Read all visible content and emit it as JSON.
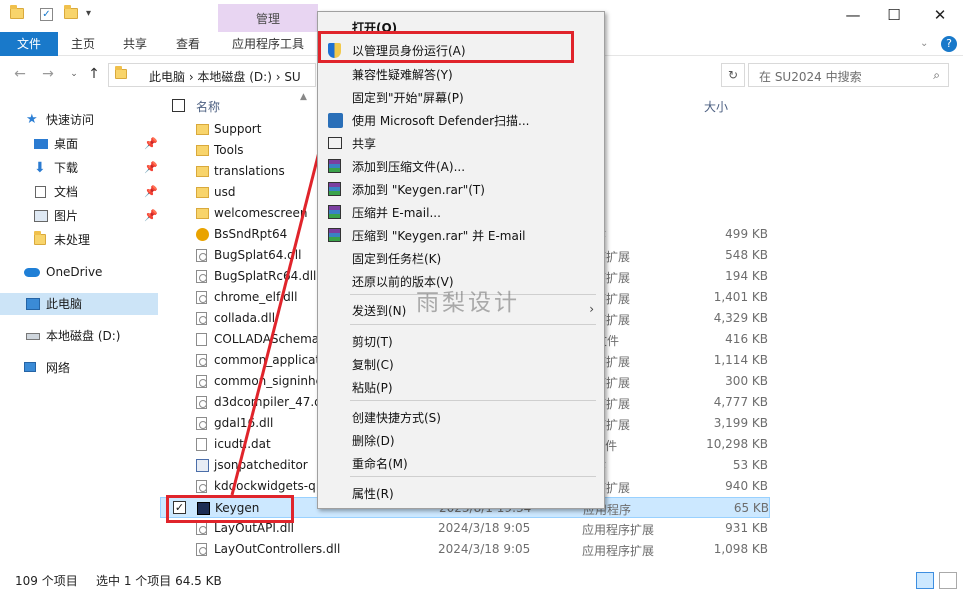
{
  "titlebar": {
    "manage_tab": "管理",
    "minimize": "—",
    "maximize": "☐",
    "close": "✕"
  },
  "ribbon": {
    "tabs": [
      "文件",
      "主页",
      "共享",
      "查看",
      "应用程序工具"
    ]
  },
  "address": {
    "breadcrumb": "此电脑  ›  本地磁盘 (D:)  ›  SU",
    "search_placeholder": "在 SU2024 中搜索"
  },
  "nav": {
    "items": [
      {
        "label": "快速访问",
        "icon": "star-icon"
      },
      {
        "label": "桌面",
        "icon": "desktop-icon",
        "pinned": true
      },
      {
        "label": "下载",
        "icon": "download-icon",
        "pinned": true
      },
      {
        "label": "文档",
        "icon": "document-icon",
        "pinned": true
      },
      {
        "label": "图片",
        "icon": "picture-icon",
        "pinned": true
      },
      {
        "label": "未处理",
        "icon": "folder-icon"
      },
      {
        "label": "OneDrive",
        "icon": "cloud-icon"
      },
      {
        "label": "此电脑",
        "icon": "pc-icon",
        "selected": true
      },
      {
        "label": "本地磁盘 (D:)",
        "icon": "drive-icon"
      },
      {
        "label": "网络",
        "icon": "network-icon"
      }
    ]
  },
  "columns": {
    "name": "名称",
    "size": "大小"
  },
  "files": [
    {
      "name": "Support",
      "date": "",
      "type": "夹",
      "size": "",
      "icon": "folder"
    },
    {
      "name": "Tools",
      "date": "",
      "type": "夹",
      "size": "",
      "icon": "folder"
    },
    {
      "name": "translations",
      "date": "",
      "type": "夹",
      "size": "",
      "icon": "folder"
    },
    {
      "name": "usd",
      "date": "",
      "type": "夹",
      "size": "",
      "icon": "folder"
    },
    {
      "name": "welcomescreen",
      "date": "",
      "type": "夹",
      "size": "",
      "icon": "folder"
    },
    {
      "name": "BsSndRpt64",
      "date": "",
      "type": "程序",
      "size": "499 KB",
      "icon": "bug"
    },
    {
      "name": "BugSplat64.dll",
      "date": "",
      "type": "程序扩展",
      "size": "548 KB",
      "icon": "dll"
    },
    {
      "name": "BugSplatRc64.dll",
      "date": "",
      "type": "程序扩展",
      "size": "194 KB",
      "icon": "dll"
    },
    {
      "name": "chrome_elf.dll",
      "date": "",
      "type": "程序扩展",
      "size": "1,401 KB",
      "icon": "dll"
    },
    {
      "name": "collada.dll",
      "date": "",
      "type": "程序扩展",
      "size": "4,329 KB",
      "icon": "dll"
    },
    {
      "name": "COLLADASchema.",
      "date": "",
      "type": "D 文件",
      "size": "416 KB",
      "icon": "doc"
    },
    {
      "name": "common_applicat",
      "date": "",
      "type": "程序扩展",
      "size": "1,114 KB",
      "icon": "dll"
    },
    {
      "name": "common_signinhe",
      "date": "",
      "type": "程序扩展",
      "size": "300 KB",
      "icon": "dll"
    },
    {
      "name": "d3dcompiler_47.d",
      "date": "",
      "type": "程序扩展",
      "size": "4,777 KB",
      "icon": "dll"
    },
    {
      "name": "gdal16.dll",
      "date": "",
      "type": "程序扩展",
      "size": "3,199 KB",
      "icon": "dll"
    },
    {
      "name": "icudtl.dat",
      "date": "",
      "type": "T 文件",
      "size": "10,298 KB",
      "icon": "doc"
    },
    {
      "name": "jsonpatcheditor",
      "date": "",
      "type": "程序",
      "size": "53 KB",
      "icon": "app"
    },
    {
      "name": "kddockwidgets-q",
      "date": "",
      "type": "程序扩展",
      "size": "940 KB",
      "icon": "dll"
    },
    {
      "name": "Keygen",
      "date": "2023/8/1 19:34",
      "type": "应用程序",
      "size": "65 KB",
      "icon": "key",
      "selected": true
    },
    {
      "name": "LayOutAPI.dll",
      "date": "2024/3/18 9:05",
      "type": "应用程序扩展",
      "size": "931 KB",
      "icon": "dll"
    },
    {
      "name": "LayOutControllers.dll",
      "date": "2024/3/18 9:05",
      "type": "应用程序扩展",
      "size": "1,098 KB",
      "icon": "dll"
    }
  ],
  "context_menu": {
    "items": [
      {
        "label": "打开(O)",
        "bold": true,
        "icon": ""
      },
      {
        "label": "以管理员身份运行(A)",
        "icon": "uac-shield-icon"
      },
      {
        "label": "兼容性疑难解答(Y)",
        "icon": ""
      },
      {
        "label": "固定到\"开始\"屏幕(P)",
        "icon": ""
      },
      {
        "label": "使用 Microsoft Defender扫描...",
        "icon": "defender-icon"
      },
      {
        "label": "共享",
        "icon": "share-icon"
      },
      {
        "label": "添加到压缩文件(A)...",
        "icon": "winrar-icon"
      },
      {
        "label": "添加到 \"Keygen.rar\"(T)",
        "icon": "winrar-icon"
      },
      {
        "label": "压缩并 E-mail...",
        "icon": "winrar-icon"
      },
      {
        "label": "压缩到 \"Keygen.rar\" 并 E-mail",
        "icon": "winrar-icon"
      },
      {
        "label": "固定到任务栏(K)",
        "icon": ""
      },
      {
        "label": "还原以前的版本(V)",
        "icon": ""
      },
      {
        "label": "发送到(N)",
        "icon": "",
        "submenu": true
      },
      {
        "label": "剪切(T)",
        "icon": ""
      },
      {
        "label": "复制(C)",
        "icon": ""
      },
      {
        "label": "粘贴(P)",
        "icon": ""
      },
      {
        "label": "创建快捷方式(S)",
        "icon": ""
      },
      {
        "label": "删除(D)",
        "icon": ""
      },
      {
        "label": "重命名(M)",
        "icon": ""
      },
      {
        "label": "属性(R)",
        "icon": ""
      }
    ]
  },
  "watermark": "雨梨设计",
  "status": {
    "item_count": "109 个项目",
    "selection": "选中 1 个项目  64.5 KB"
  },
  "colors": {
    "accent": "#1979ca",
    "annotation": "#e0242b",
    "selection": "#cce8ff"
  }
}
